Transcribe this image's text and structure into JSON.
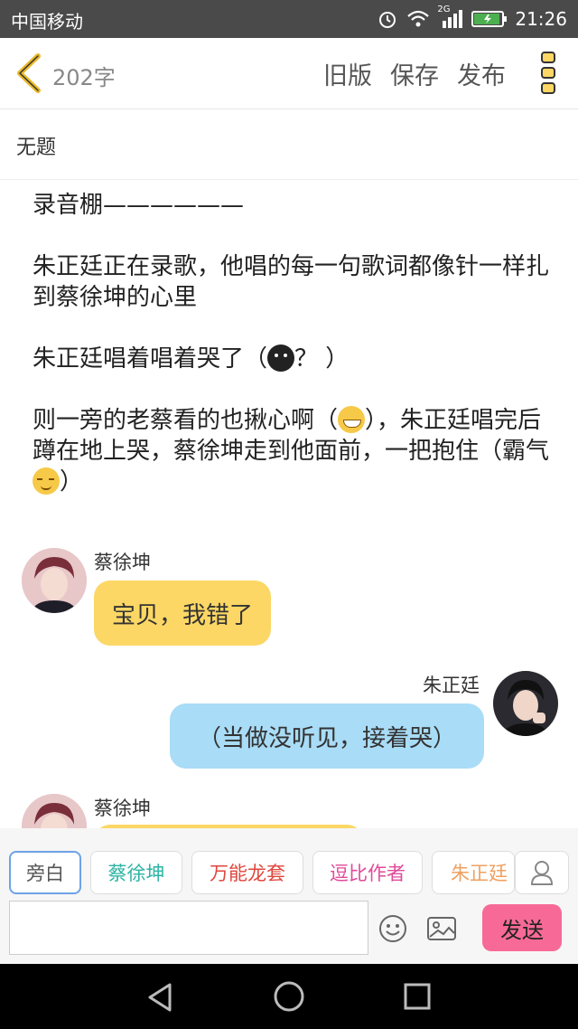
{
  "status_bar": {
    "carrier": "中国移动",
    "network": "2G",
    "time": "21:26"
  },
  "toolbar": {
    "word_count": "202字",
    "old_version": "旧版",
    "save": "保存",
    "publish": "发布"
  },
  "doc": {
    "title": "无题"
  },
  "narration": {
    "p1": "录音棚——————",
    "p2": "朱正廷正在录歌，他唱的每一句歌词都像针一样扎到蔡徐坤的心里",
    "p3a": "朱正廷唱着唱着哭了（",
    "p3b": "？ ）",
    "p4a": "则一旁的老蔡看的也揪心啊（",
    "p4b": "），朱正廷唱完后蹲在地上哭，蔡徐坤走到他面前，一把抱住（霸气",
    "p4c": "）"
  },
  "messages": [
    {
      "speaker": "蔡徐坤",
      "text": "宝贝，我错了",
      "side": "left"
    },
    {
      "speaker": "朱正廷",
      "text": "（当做没听见，接着哭）",
      "side": "right"
    },
    {
      "speaker": "蔡徐坤",
      "text": "",
      "side": "left"
    }
  ],
  "roles": [
    "旁白",
    "蔡徐坤",
    "万能龙套",
    "逗比作者",
    "朱正廷"
  ],
  "role_colors": [
    "#555555",
    "#2bb3a3",
    "#e0463c",
    "#e14a9a",
    "#f0a060"
  ],
  "composer": {
    "input_value": "",
    "send": "发送"
  },
  "icons": [
    "back-chevron-icon",
    "more-vertical-icon",
    "smiley-icon",
    "image-icon",
    "person-icon",
    "nav-back-icon",
    "nav-home-icon",
    "nav-recent-icon"
  ]
}
